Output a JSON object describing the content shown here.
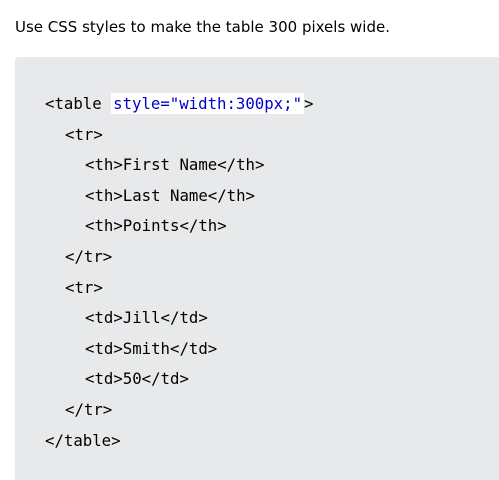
{
  "instruction": "Use CSS styles to make the table 300 pixels wide.",
  "code": {
    "table_open_prefix": "<table",
    "table_open_attr": "style=\"width:300px;\"",
    "table_open_suffix": ">",
    "tr_open_1": "<tr>",
    "th_first": "<th>First Name</th>",
    "th_last": "<th>Last Name</th>",
    "th_points": "<th>Points</th>",
    "tr_close_1": "</tr>",
    "tr_open_2": "<tr>",
    "td_first": "<td>Jill</td>",
    "td_last": "<td>Smith</td>",
    "td_points": "<td>50</td>",
    "tr_close_2": "</tr>",
    "table_close": "</table>"
  }
}
